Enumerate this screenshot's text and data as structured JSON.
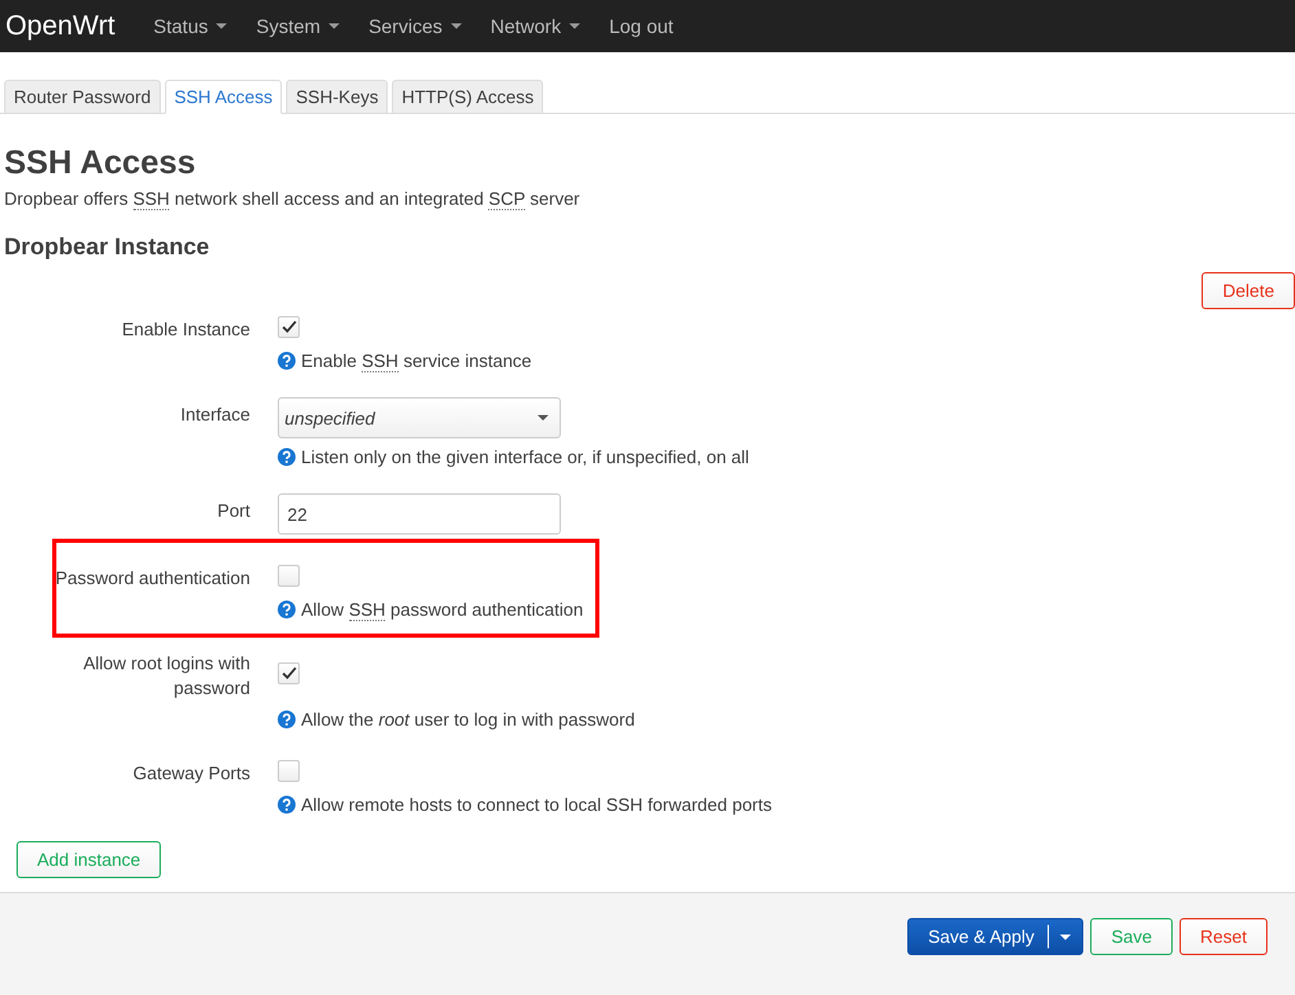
{
  "navbar": {
    "brand": "OpenWrt",
    "menu": [
      {
        "label": "Status",
        "has_menu": true
      },
      {
        "label": "System",
        "has_menu": true
      },
      {
        "label": "Services",
        "has_menu": true
      },
      {
        "label": "Network",
        "has_menu": true
      },
      {
        "label": "Log out",
        "has_menu": false
      }
    ]
  },
  "tabs": [
    {
      "label": "Router Password",
      "selected": false
    },
    {
      "label": "SSH Access",
      "selected": true
    },
    {
      "label": "SSH-Keys",
      "selected": false
    },
    {
      "label": "HTTP(S) Access",
      "selected": false
    }
  ],
  "page": {
    "title": "SSH Access",
    "description": [
      {
        "kind": "text",
        "text": "Dropbear offers "
      },
      {
        "kind": "abbr",
        "text": "SSH"
      },
      {
        "kind": "text",
        "text": " network shell access and an integrated "
      },
      {
        "kind": "abbr",
        "text": "SCP"
      },
      {
        "kind": "text",
        "text": " server"
      }
    ]
  },
  "section": {
    "title": "Dropbear Instance",
    "delete_button": "Delete",
    "fields": [
      {
        "label": "Enable Instance",
        "kind": "checkbox",
        "checked": true,
        "highlighted": false,
        "description": [
          {
            "kind": "text",
            "text": "Enable "
          },
          {
            "kind": "abbr",
            "text": "SSH"
          },
          {
            "kind": "text",
            "text": " service instance"
          }
        ]
      },
      {
        "label": "Interface",
        "kind": "select",
        "value": "unspecified",
        "highlighted": false,
        "description": [
          {
            "kind": "text",
            "text": "Listen only on the given interface or, if unspecified, on all"
          }
        ]
      },
      {
        "label": "Port",
        "kind": "text",
        "value": "22",
        "highlighted": false
      },
      {
        "label": "Password authentication",
        "kind": "checkbox",
        "checked": false,
        "highlighted": true,
        "description": [
          {
            "kind": "text",
            "text": "Allow "
          },
          {
            "kind": "abbr",
            "text": "SSH"
          },
          {
            "kind": "text",
            "text": " password authentication"
          }
        ]
      },
      {
        "label": "Allow root logins with password",
        "kind": "checkbox",
        "checked": true,
        "highlighted": false,
        "description": [
          {
            "kind": "text",
            "text": "Allow the "
          },
          {
            "kind": "em",
            "text": "root"
          },
          {
            "kind": "text",
            "text": " user to log in with password"
          }
        ]
      },
      {
        "label": "Gateway Ports",
        "kind": "checkbox",
        "checked": false,
        "highlighted": false,
        "description": [
          {
            "kind": "text",
            "text": "Allow remote hosts to connect to local SSH forwarded ports"
          }
        ]
      }
    ],
    "add_button": "Add instance"
  },
  "footer": {
    "save_apply": "Save & Apply",
    "save": "Save",
    "reset": "Reset"
  }
}
